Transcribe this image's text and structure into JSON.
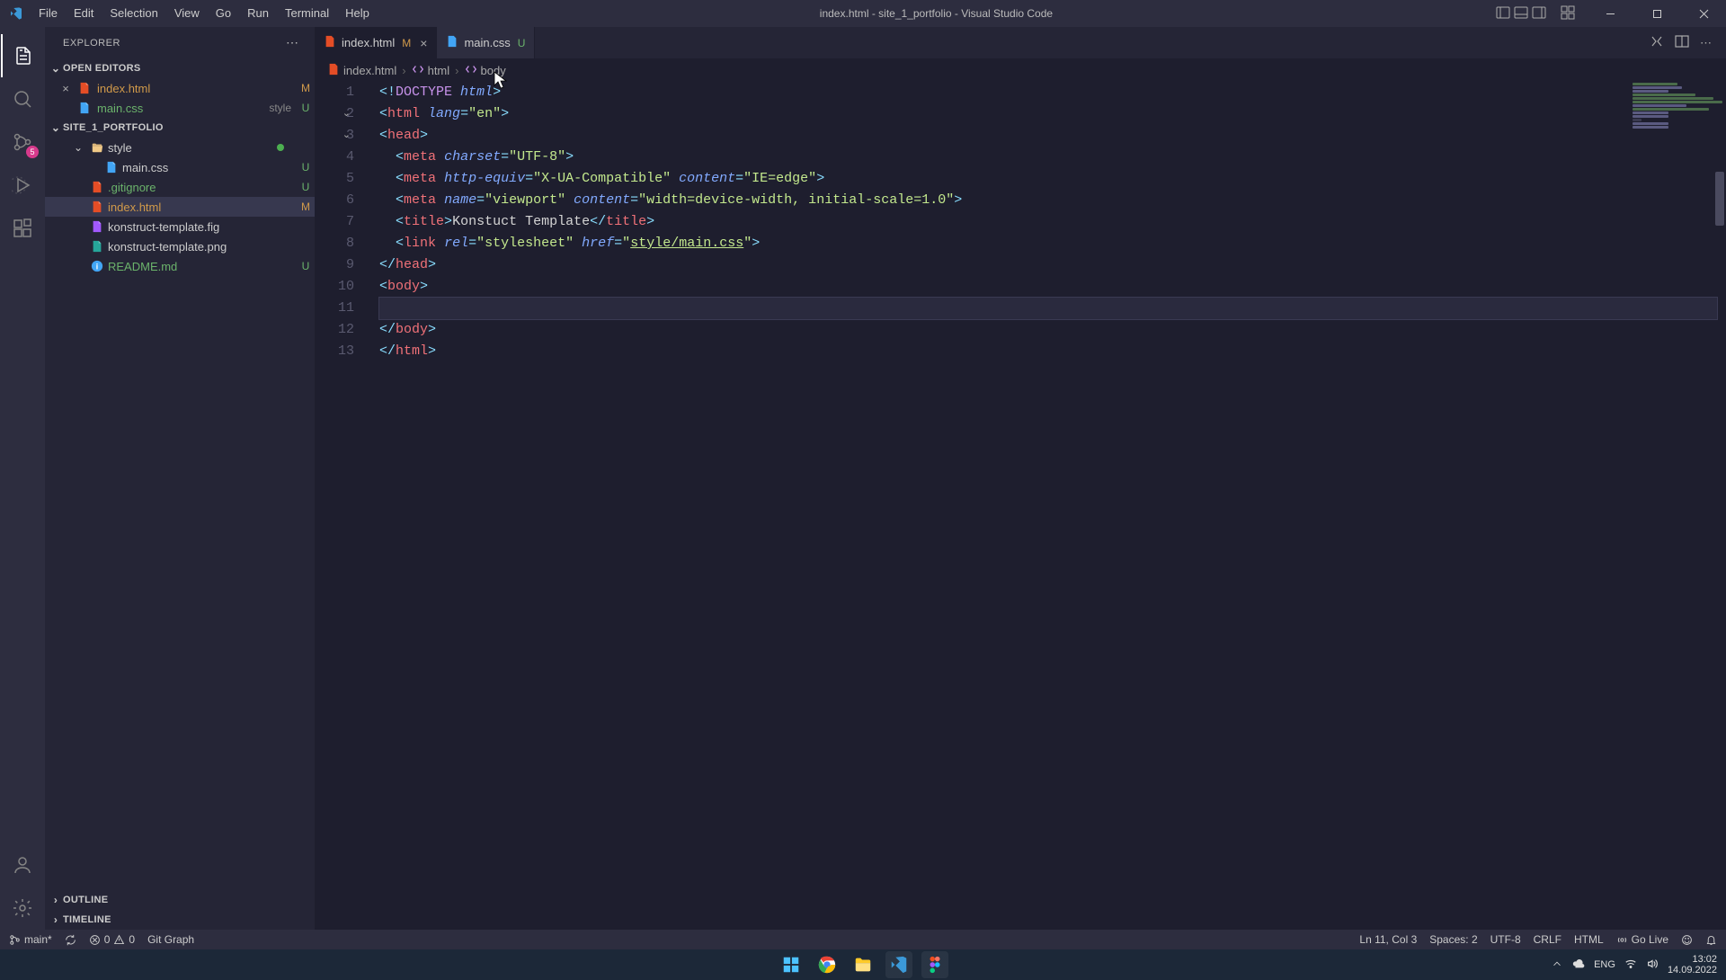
{
  "titlebar": {
    "menus": [
      "File",
      "Edit",
      "Selection",
      "View",
      "Go",
      "Run",
      "Terminal",
      "Help"
    ],
    "title": "index.html - site_1_portfolio - Visual Studio Code"
  },
  "activitybar": {
    "scm_badge": "5"
  },
  "sidebar": {
    "title": "EXPLORER",
    "openEditors": {
      "label": "OPEN EDITORS",
      "items": [
        {
          "name": "index.html",
          "status": "M",
          "statusClass": "c-m",
          "hasClose": true
        },
        {
          "name": "main.css",
          "dim": "style",
          "status": "U",
          "statusClass": "c-u"
        }
      ]
    },
    "project": {
      "label": "SITE_1_PORTFOLIO",
      "tree": [
        {
          "indent": 1,
          "type": "folder-open",
          "name": "style",
          "greenDot": true
        },
        {
          "indent": 2,
          "type": "css",
          "name": "main.css",
          "status": "U",
          "statusClass": "c-u"
        },
        {
          "indent": 1,
          "type": "git",
          "name": ".gitignore",
          "status": "U",
          "statusClass": "c-u",
          "nameClass": "c-u"
        },
        {
          "indent": 1,
          "type": "html",
          "name": "index.html",
          "status": "M",
          "statusClass": "c-m",
          "nameClass": "c-m",
          "selected": true
        },
        {
          "indent": 1,
          "type": "fig",
          "name": "konstruct-template.fig"
        },
        {
          "indent": 1,
          "type": "img",
          "name": "konstruct-template.png"
        },
        {
          "indent": 1,
          "type": "info",
          "name": "README.md",
          "status": "U",
          "statusClass": "c-u",
          "nameClass": "c-u"
        }
      ]
    },
    "outline": "OUTLINE",
    "timeline": "TIMELINE"
  },
  "tabs": [
    {
      "name": "index.html",
      "status": "M",
      "statusClass": "c-m",
      "active": true,
      "close": true,
      "iconColor": "#e44d26"
    },
    {
      "name": "main.css",
      "status": "U",
      "statusClass": "c-u",
      "iconColor": "#42a5f5"
    }
  ],
  "breadcrumb": {
    "items": [
      {
        "icon": "html",
        "label": "index.html"
      },
      {
        "icon": "tag",
        "label": "html"
      },
      {
        "icon": "tag",
        "label": "body"
      }
    ]
  },
  "code": {
    "lines": [
      {
        "n": 1,
        "html": "<span class='p-punc'>&lt;!</span><span class='p-kw'>DOCTYPE</span> <span class='p-attr'>html</span><span class='p-punc'>&gt;</span>"
      },
      {
        "n": 2,
        "fold": true,
        "html": "<span class='p-punc'>&lt;</span><span class='p-tag'>html</span> <span class='p-attr'>lang</span><span class='p-punc'>=</span><span class='p-str'>\"en\"</span><span class='p-punc'>&gt;</span>"
      },
      {
        "n": 3,
        "fold": true,
        "html": "<span class='p-punc'>&lt;</span><span class='p-tag'>head</span><span class='p-punc'>&gt;</span>"
      },
      {
        "n": 4,
        "html": "  <span class='p-punc'>&lt;</span><span class='p-tag'>meta</span> <span class='p-attr'>charset</span><span class='p-punc'>=</span><span class='p-str'>\"UTF-8\"</span><span class='p-punc'>&gt;</span>"
      },
      {
        "n": 5,
        "html": "  <span class='p-punc'>&lt;</span><span class='p-tag'>meta</span> <span class='p-attr'>http-equiv</span><span class='p-punc'>=</span><span class='p-str'>\"X-UA-Compatible\"</span> <span class='p-attr'>content</span><span class='p-punc'>=</span><span class='p-str'>\"IE=edge\"</span><span class='p-punc'>&gt;</span>"
      },
      {
        "n": 6,
        "html": "  <span class='p-punc'>&lt;</span><span class='p-tag'>meta</span> <span class='p-attr'>name</span><span class='p-punc'>=</span><span class='p-str'>\"viewport\"</span> <span class='p-attr'>content</span><span class='p-punc'>=</span><span class='p-str'>\"width=device-width, initial-scale=1.0\"</span><span class='p-punc'>&gt;</span>"
      },
      {
        "n": 7,
        "html": "  <span class='p-punc'>&lt;</span><span class='p-tag'>title</span><span class='p-punc'>&gt;</span>Konstuct Template<span class='p-punc'>&lt;/</span><span class='p-tag'>title</span><span class='p-punc'>&gt;</span>"
      },
      {
        "n": 8,
        "html": "  <span class='p-punc'>&lt;</span><span class='p-tag'>link</span> <span class='p-attr'>rel</span><span class='p-punc'>=</span><span class='p-str'>\"stylesheet\"</span> <span class='p-attr'>href</span><span class='p-punc'>=</span><span class='p-str'>\"<span class='p-underline'>style/main.css</span>\"</span><span class='p-punc'>&gt;</span>"
      },
      {
        "n": 9,
        "html": "<span class='p-punc'>&lt;/</span><span class='p-tag'>head</span><span class='p-punc'>&gt;</span>"
      },
      {
        "n": 10,
        "html": "<span class='p-punc'>&lt;</span><span class='p-tag'>body</span><span class='p-punc'>&gt;</span>"
      },
      {
        "n": 11,
        "current": true,
        "html": "  "
      },
      {
        "n": 12,
        "html": "<span class='p-punc'>&lt;/</span><span class='p-tag'>body</span><span class='p-punc'>&gt;</span>"
      },
      {
        "n": 13,
        "html": "<span class='p-punc'>&lt;/</span><span class='p-tag'>html</span><span class='p-punc'>&gt;</span>"
      }
    ]
  },
  "status": {
    "branch": "main*",
    "errors": "0",
    "warnings": "0",
    "gitgraph": "Git Graph",
    "lncol": "Ln 11, Col 3",
    "spaces": "Spaces: 2",
    "encoding": "UTF-8",
    "eol": "CRLF",
    "lang": "HTML",
    "golive": "Go Live"
  },
  "taskbar": {
    "lang": "ENG",
    "time": "13:02",
    "date": "14.09.2022"
  }
}
